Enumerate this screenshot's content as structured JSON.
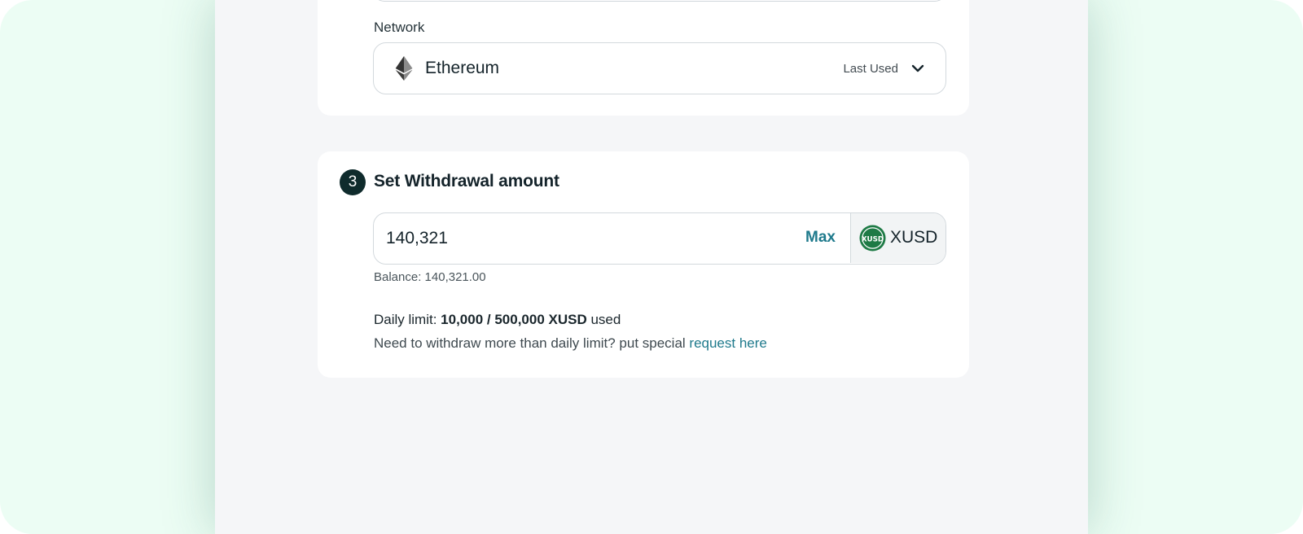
{
  "network": {
    "label": "Network",
    "selected": "Ethereum",
    "tag": "Last Used",
    "icon": "ethereum-icon"
  },
  "withdrawal": {
    "step_number": "3",
    "title": "Set Withdrawal amount",
    "amount_value": "140,321",
    "max_label": "Max",
    "token_label": "XUSD",
    "token_icon_text": "XUSD",
    "balance_text": "Balance: 140,321.00",
    "daily_limit_prefix": "Daily limit: ",
    "daily_limit_used": "10,000",
    "daily_limit_sep": " / ",
    "daily_limit_total": "500,000 XUSD",
    "daily_limit_suffix": " used",
    "request_prefix": "Need to withdraw more than daily limit? put special ",
    "request_link": "request here"
  },
  "colors": {
    "accent": "#1f7a8c",
    "badge": "#0f2b2c",
    "token_green": "#1e7a45",
    "page_bg": "#ecfdf4",
    "panel_bg": "#f5f6f8"
  }
}
